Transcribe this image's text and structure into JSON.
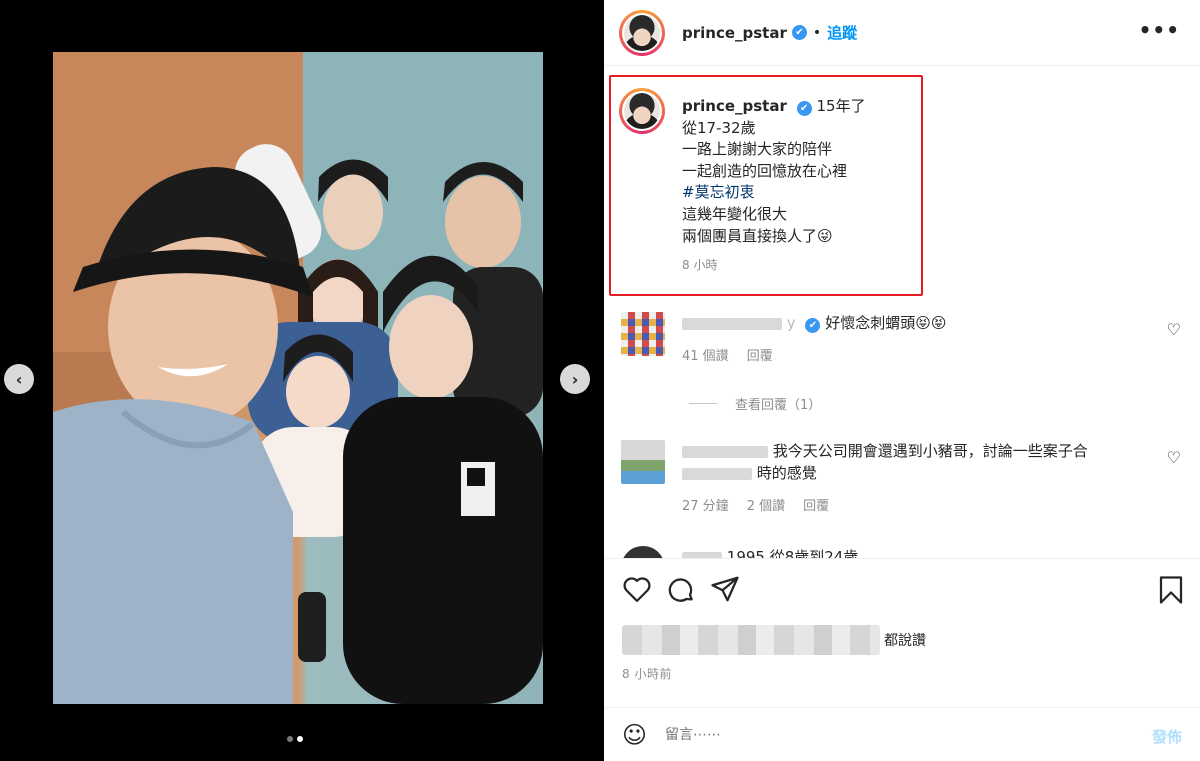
{
  "post": {
    "username": "prince_pstar",
    "verified_icon": "✔",
    "dot": "•",
    "follow_label": "追蹤",
    "more_label": "•••"
  },
  "caption": {
    "username": "prince_pstar",
    "lines": [
      "15年了",
      "從17-32歲",
      "一路上謝謝大家的陪伴",
      "一起創造的回憶放在心裡",
      "#莫忘初衷",
      "這幾年變化很大",
      "兩個團員直接換人了😜"
    ],
    "time": "8 小時"
  },
  "comments": [
    {
      "name_suffix": "y",
      "text": "好懷念刺蝟頭😝😝",
      "meta": [
        "41 個讚",
        "回覆"
      ],
      "view_replies": "查看回覆（1）"
    },
    {
      "text_line1": "我今天公司開會還遇到小豬哥，討論一些案子合",
      "text_line2": "時的感覺",
      "meta": [
        "27 分鐘",
        "2 個讚",
        "回覆"
      ]
    },
    {
      "text_partial": "1995 從8歲到24歲"
    }
  ],
  "actions": {
    "likes_suffix": "都說讚",
    "post_time": "8 小時前",
    "comment_placeholder": "留言⋯⋯",
    "post_label": "發佈",
    "emoji_icon": "☺"
  },
  "media": {
    "prev_arrow": "‹",
    "next_arrow": "›",
    "slide_count": 2,
    "active_slide": 2
  },
  "colors": {
    "accent": "#0095f6",
    "highlight_border": "#e51c23",
    "hashtag": "#00376b",
    "muted": "#8e8e8e"
  }
}
